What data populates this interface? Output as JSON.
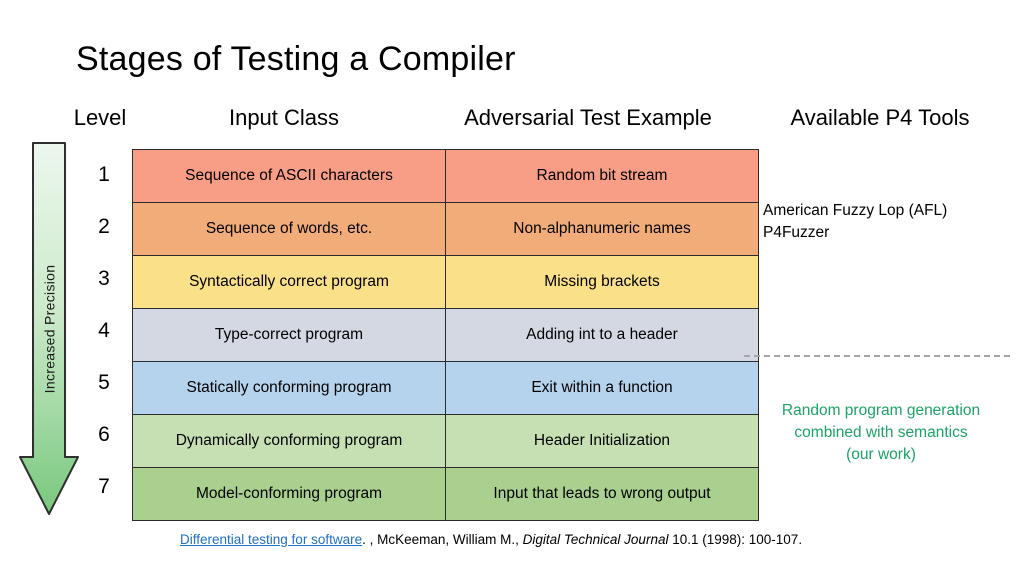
{
  "slide": {
    "title": "Stages of Testing a Compiler"
  },
  "headers": {
    "level": "Level",
    "input_class": "Input Class",
    "adversarial": "Adversarial Test Example",
    "tools": "Available P4 Tools"
  },
  "arrow": {
    "label": "Increased Precision",
    "direction": "down",
    "gradient_top": "#E8F5E9",
    "gradient_bottom": "#7AC97E",
    "outline": "#2b2b2b"
  },
  "rows": [
    {
      "level": "1",
      "input_class": "Sequence of ASCII characters",
      "adversarial": "Random bit stream",
      "color": "#F99E86"
    },
    {
      "level": "2",
      "input_class": "Sequence of words, etc.",
      "adversarial": "Non-alphanumeric names",
      "color": "#F2AC79"
    },
    {
      "level": "3",
      "input_class": "Syntactically correct program",
      "adversarial": "Missing brackets",
      "color": "#FBE08A"
    },
    {
      "level": "4",
      "input_class": "Type-correct program",
      "adversarial": "Adding int to a header",
      "color": "#D3D8E3"
    },
    {
      "level": "5",
      "input_class": "Statically conforming program",
      "adversarial": "Exit within a function",
      "color": "#B6D3ED"
    },
    {
      "level": "6",
      "input_class": "Dynamically conforming program",
      "adversarial": "Header Initialization",
      "color": "#C6E0B4"
    },
    {
      "level": "7",
      "input_class": "Model-conforming program",
      "adversarial": "Input that leads to wrong output",
      "color": "#A9D08E"
    }
  ],
  "annotations": {
    "existing_tools": "American Fuzzy Lop (AFL)\nP4Fuzzer",
    "existing_tools_lines": [
      "American Fuzzy Lop (AFL)",
      "P4Fuzzer"
    ],
    "our_work_lines": [
      "Random program generation",
      "combined with semantics",
      "(our work)"
    ],
    "our_work_color": "#1BA366",
    "divider_color": "#a6a6a6"
  },
  "citation": {
    "link_text": "Differential testing for software",
    "after_link": ". , McKeeman, William M., ",
    "journal": "Digital Technical Journal",
    "tail": " 10.1 (1998): 100-107."
  }
}
